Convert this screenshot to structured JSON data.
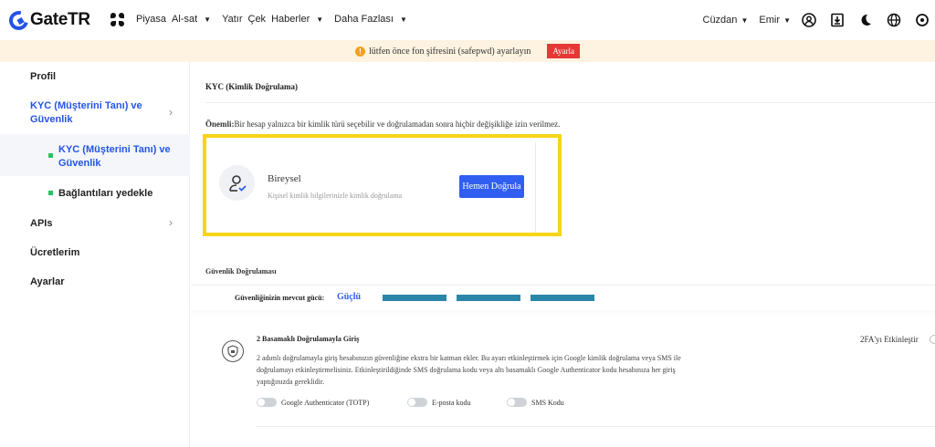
{
  "brand": {
    "logo_text": "GateTR",
    "accent": "#2354e6"
  },
  "nav": {
    "items": [
      "Piyasa",
      "Al-sat",
      "Yatır",
      "Çek",
      "Haberler",
      "Daha Fazlası"
    ],
    "wallet": "Cüzdan",
    "user": "Emir",
    "icons": [
      "profile-icon",
      "download-icon",
      "dark-mode-icon",
      "globe-icon",
      "settings-icon"
    ]
  },
  "notice": {
    "text": "lütfen önce fon şifresini (safepwd) ayarlayın",
    "button": "Ayarla"
  },
  "sidebar": {
    "items": [
      {
        "label": "Profil"
      },
      {
        "label_line1": "KYC (Müşterini Tanı) ve",
        "label_line2": "Güvenlik"
      },
      {
        "label_line1": "KYC (Müşterini Tanı) ve",
        "label_line2": "Güvenlik"
      },
      {
        "label": "Bağlantıları yedekle"
      },
      {
        "label": "APIs"
      },
      {
        "label": "Ücretlerim"
      },
      {
        "label": "Ayarlar"
      }
    ]
  },
  "kyc": {
    "heading": "KYC (Kimlik Doğrulama)",
    "important_label": "Önemli:",
    "important_text": "Bir hesap yalnızca bir kimlik türü seçebilir ve doğrulamadan sonra hiçbir değişikliğe izin verilmez.",
    "card_title": "Bireysel",
    "card_subtitle": "Kişisel kimlik bilgilerinizle kimlik doğrulama",
    "card_button": "Hemen Doğrula"
  },
  "security": {
    "heading": "Güvenlik Doğrulaması",
    "strength_label": "Güvenliğinizin mevcut gücü:",
    "strength_value": "Güçlü",
    "strength_level": 1.0,
    "twofa": {
      "title": "2 Basamaklı Doğrulamayla Giriş",
      "description": "2 adımlı doğrulamayla giriş hesabınızın güvenliğine ekstra bir katman ekler. Bu ayarı etkinleştirmek için Google kimlik doğrulama veya SMS ile doğrulamayı etkinleştirmelisiniz. Etkinleştirildiğinde SMS doğrulama kodu veya altı basamaklı Google Authenticator kodu hesabınıza her giriş yaptığınızda gereklidir.",
      "enable_label": "2FA'yı Etkinleştir",
      "methods": [
        "Google Authenticator (TOTP)",
        "E-posta kodu",
        "SMS Kodu"
      ]
    }
  }
}
